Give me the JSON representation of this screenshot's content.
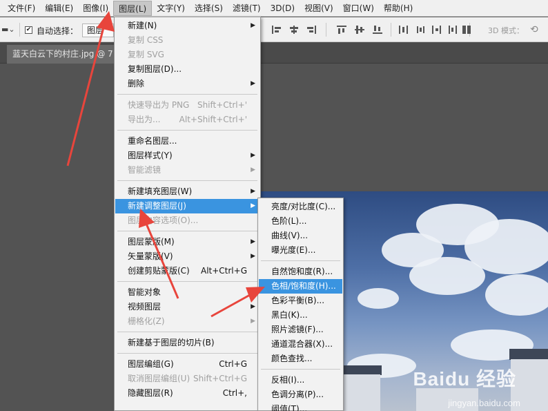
{
  "menubar": {
    "items": [
      {
        "label": "文件(F)"
      },
      {
        "label": "编辑(E)"
      },
      {
        "label": "图像(I)"
      },
      {
        "label": "图层(L)",
        "active": true
      },
      {
        "label": "文字(Y)"
      },
      {
        "label": "选择(S)"
      },
      {
        "label": "滤镜(T)"
      },
      {
        "label": "3D(D)"
      },
      {
        "label": "视图(V)"
      },
      {
        "label": "窗口(W)"
      },
      {
        "label": "帮助(H)"
      }
    ]
  },
  "options": {
    "auto_select_label": "自动选择：",
    "auto_select_checked": true,
    "auto_select_target": "图层",
    "mode_label": "3D 模式："
  },
  "document": {
    "tab_title": "蓝天白云下的村庄.jpg @ 7"
  },
  "layer_menu": [
    {
      "type": "item",
      "label": "新建(N)",
      "submenu": true
    },
    {
      "type": "item",
      "label": "复制 CSS",
      "disabled": true
    },
    {
      "type": "item",
      "label": "复制 SVG",
      "disabled": true
    },
    {
      "type": "item",
      "label": "复制图层(D)..."
    },
    {
      "type": "item",
      "label": "删除",
      "submenu": true
    },
    {
      "type": "sep"
    },
    {
      "type": "item",
      "label": "快速导出为 PNG",
      "shortcut": "Shift+Ctrl+'",
      "disabled": true
    },
    {
      "type": "item",
      "label": "导出为...",
      "shortcut": "Alt+Shift+Ctrl+'",
      "disabled": true
    },
    {
      "type": "sep"
    },
    {
      "type": "item",
      "label": "重命名图层..."
    },
    {
      "type": "item",
      "label": "图层样式(Y)",
      "submenu": true
    },
    {
      "type": "item",
      "label": "智能滤镜",
      "submenu": true,
      "disabled": true
    },
    {
      "type": "sep"
    },
    {
      "type": "item",
      "label": "新建填充图层(W)",
      "submenu": true
    },
    {
      "type": "item",
      "label": "新建调整图层(J)",
      "submenu": true,
      "highlighted": true
    },
    {
      "type": "item",
      "label": "图层内容选项(O)...",
      "disabled": true
    },
    {
      "type": "sep"
    },
    {
      "type": "item",
      "label": "图层蒙版(M)",
      "submenu": true
    },
    {
      "type": "item",
      "label": "矢量蒙版(V)",
      "submenu": true
    },
    {
      "type": "item",
      "label": "创建剪贴蒙版(C)",
      "shortcut": "Alt+Ctrl+G"
    },
    {
      "type": "sep"
    },
    {
      "type": "item",
      "label": "智能对象",
      "submenu": true
    },
    {
      "type": "item",
      "label": "视频图层",
      "submenu": true
    },
    {
      "type": "item",
      "label": "栅格化(Z)",
      "submenu": true,
      "disabled": true
    },
    {
      "type": "sep"
    },
    {
      "type": "item",
      "label": "新建基于图层的切片(B)"
    },
    {
      "type": "sep"
    },
    {
      "type": "item",
      "label": "图层编组(G)",
      "shortcut": "Ctrl+G"
    },
    {
      "type": "item",
      "label": "取消图层编组(U)",
      "shortcut": "Shift+Ctrl+G",
      "disabled": true
    },
    {
      "type": "item",
      "label": "隐藏图层(R)",
      "shortcut": "Ctrl+,"
    }
  ],
  "adjust_menu": [
    {
      "type": "item",
      "label": "亮度/对比度(C)..."
    },
    {
      "type": "item",
      "label": "色阶(L)..."
    },
    {
      "type": "item",
      "label": "曲线(V)..."
    },
    {
      "type": "item",
      "label": "曝光度(E)..."
    },
    {
      "type": "sep"
    },
    {
      "type": "item",
      "label": "自然饱和度(R)..."
    },
    {
      "type": "item",
      "label": "色相/饱和度(H)...",
      "highlighted": true
    },
    {
      "type": "item",
      "label": "色彩平衡(B)..."
    },
    {
      "type": "item",
      "label": "黑白(K)..."
    },
    {
      "type": "item",
      "label": "照片滤镜(F)..."
    },
    {
      "type": "item",
      "label": "通道混合器(X)..."
    },
    {
      "type": "item",
      "label": "颜色查找..."
    },
    {
      "type": "sep"
    },
    {
      "type": "item",
      "label": "反相(I)..."
    },
    {
      "type": "item",
      "label": "色调分离(P)..."
    },
    {
      "type": "item",
      "label": "阈值(T)..."
    }
  ],
  "watermark": {
    "logo_text": "Baidu 经验",
    "url_text": "jingyan.baidu.com"
  },
  "colors": {
    "highlight": "#3a94e0",
    "annotation_arrow": "#e8453c"
  }
}
